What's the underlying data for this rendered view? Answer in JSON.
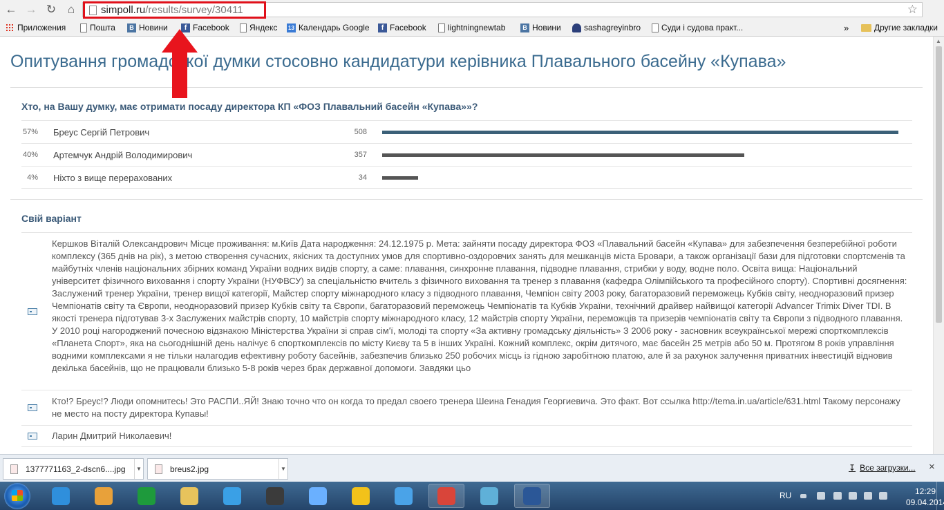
{
  "browser": {
    "url_host": "simpoll.ru",
    "url_path": "/results/survey/30411",
    "bookmarks": [
      {
        "label": "Приложения",
        "icon": "apps-grid-icon"
      },
      {
        "label": "Пошта",
        "icon": "page-icon"
      },
      {
        "label": "Новини",
        "icon": "vk-icon"
      },
      {
        "label": "Facebook",
        "icon": "facebook-icon"
      },
      {
        "label": "Яндекс",
        "icon": "page-icon"
      },
      {
        "label": "Календарь Google",
        "icon": "calendar-icon"
      },
      {
        "label": "Facebook",
        "icon": "facebook-icon"
      },
      {
        "label": "lightningnewtab",
        "icon": "page-icon"
      },
      {
        "label": "Новини",
        "icon": "vk-icon"
      },
      {
        "label": "sashagreyinbro",
        "icon": "user-icon"
      },
      {
        "label": "Суди і судова практ...",
        "icon": "page-icon"
      }
    ],
    "bookmarks_overflow": "»",
    "other_bookmarks": "Другие закладки"
  },
  "survey": {
    "title": "Опитування громадської думки стосовно кандидатури керівника Плавального басейну «Купава»",
    "question": "Хто, на Вашу думку, має отримати посаду директора КП «ФОЗ Плавальний басейн «Купава»»?",
    "answers": [
      {
        "pct": "57%",
        "name": "Бреус Сергій Петрович",
        "count": "508",
        "share": 0.57
      },
      {
        "pct": "40%",
        "name": "Артемчук Андрій Володимирович",
        "count": "357",
        "share": 0.4
      },
      {
        "pct": "4%",
        "name": "Ніхто з вище перерахованих",
        "count": "34",
        "share": 0.04
      }
    ],
    "bar_colors": [
      "#3b6078",
      "#555555",
      "#555555"
    ],
    "own_variant_title": "Свій варіант",
    "responses": [
      "Кершков Віталій Олександрович Місце проживання: м.Київ Дата народження: 24.12.1975 р. Мета: зайняти посаду директора ФОЗ «Плавальний басейн «Купава» для забезпечення безперебійної роботи комплексу (365 днів на рік), з метою створення сучасних, якісних та доступних умов для спортивно-оздоровчих занять для мешканців міста Бровари, а також організації бази для підготовки спортсменів та майбутніх членів національних збірних команд України водних видів спорту, а саме: плавання, синхронне плавання, підводне плавання, стрибки у воду, водне поло. Освіта вища: Національний університет фізичного виховання і спорту України (НУФВСУ) за спеціальністю вчитель з фізичного виховання та тренер з плавання (кафедра Олімпійського та професійного спорту). Спортивні досягнення: Заслужений тренер України, тренер вищої категорії, Майстер спорту міжнародного класу з підводного плавання, Чемпіон світу 2003 року, багаторазовий переможець Кубків світу, неодноразовий призер Чемпіонатів світу та Європи, неодноразовий призер Кубків світу та Європи, багаторазовий переможець Чемпіонатів та Кубків України, технічний драйвер найвищої категорії Advancer Trimix Diver TDI. В якості тренера підготував 3-х Заслужених майстрів спорту, 10 майстрів спорту міжнародного класу, 12 майстрів спорту України, переможців та призерів чемпіонатів світу та Європи з підводного плавання. У 2010 році нагороджений почесною відзнакою Міністерства України зі справ сім'ї, молоді та спорту «За активну громадську діяльність» З 2006 року - засновник всеукраїнської мережі спорткомплексів «Планета Спорт», яка на сьогоднішній день налічує 6 спорткомплексів по місту Києву та 5 в інших Україні. Кожний комплекс, окрім дитячого, має басейн 25 метрів або 50 м. Протягом 8 років управління водними комплексами я не тільки налагодив ефективну роботу басейнів, забезпечив близько 250 робочих місць із гідною заробітною платою, але й за рахунок залучення приватних інвестицій відновив декілька басейнів, що не працювали близько 5-8 років через брак державної допомоги. Завдяки цьо",
      "Кто!? Бреус!? Люди опомнитесь! Это РАСПИ..ЯЙ! Знаю точно что он когда то предал своего тренера Шеина Генадия Георгиевича. Это факт. Вот ссылка http://tema.in.ua/article/631.html Такому персонажу не место на посту директора Купавы!",
      "Ларин Дмитрий Николаевич!"
    ]
  },
  "downloads": {
    "items": [
      "1377771163_2-dscn6....jpg",
      "breus2.jpg"
    ],
    "all_label": "Все загрузки..."
  },
  "taskbar": {
    "apps": [
      {
        "icon": "internet-explorer-icon",
        "color": "#2f8fdc"
      },
      {
        "icon": "media-player-icon",
        "color": "#e8a13a"
      },
      {
        "icon": "stock-chart-app-icon",
        "color": "#1e9a3c"
      },
      {
        "icon": "file-explorer-icon",
        "color": "#e7c35c"
      },
      {
        "icon": "network-icon",
        "color": "#3aa0e6"
      },
      {
        "icon": "media-app-icon",
        "color": "#3b3b3b"
      },
      {
        "icon": "itunes-icon",
        "color": "#6ab0ff"
      },
      {
        "icon": "vlc-app-icon",
        "color": "#f2c21a"
      },
      {
        "icon": "photo-viewer-icon",
        "color": "#4aa3e8"
      },
      {
        "icon": "chrome-icon",
        "color": "#d9453a"
      },
      {
        "icon": "video-player-icon",
        "color": "#5fb0d8"
      },
      {
        "icon": "word-icon",
        "color": "#2b5797"
      }
    ],
    "language": "RU",
    "time": "12:29",
    "date": "09.04.2014"
  }
}
